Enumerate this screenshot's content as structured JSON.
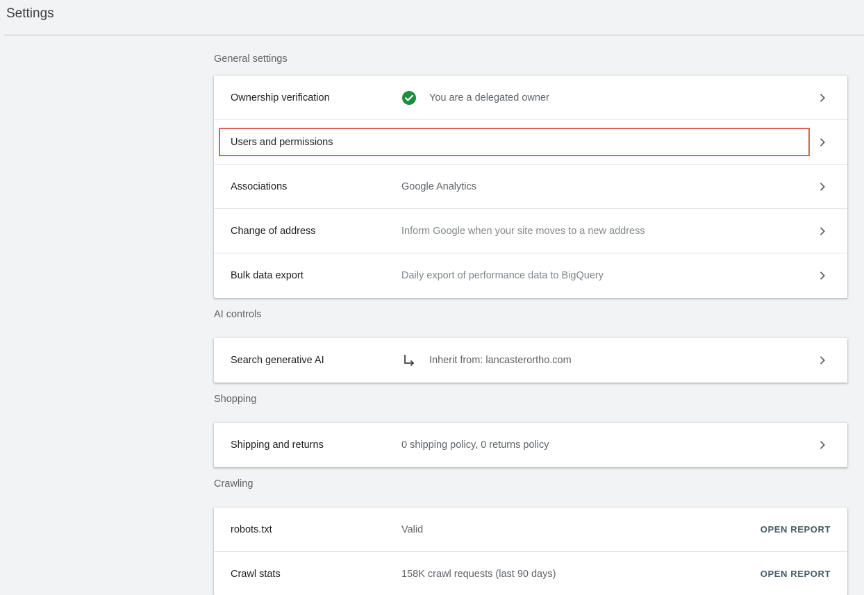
{
  "header": {
    "title": "Settings"
  },
  "sections": {
    "general": {
      "title": "General settings",
      "rows": {
        "ownership": {
          "label": "Ownership verification",
          "value": "You are a delegated owner",
          "icon": "check-circle-icon"
        },
        "users": {
          "label": "Users and permissions"
        },
        "associations": {
          "label": "Associations",
          "value": "Google Analytics"
        },
        "address": {
          "label": "Change of address",
          "value": "Inform Google when your site moves to a new address"
        },
        "bulk": {
          "label": "Bulk data export",
          "value": "Daily export of performance data to BigQuery"
        }
      }
    },
    "ai": {
      "title": "AI controls",
      "rows": {
        "generative": {
          "label": "Search generative AI",
          "value": "Inherit from: lancasterortho.com",
          "icon": "subdirectory-arrow-icon"
        }
      }
    },
    "shopping": {
      "title": "Shopping",
      "rows": {
        "shipping": {
          "label": "Shipping and returns",
          "value": "0 shipping policy, 0 returns policy"
        }
      }
    },
    "crawling": {
      "title": "Crawling",
      "rows": {
        "robots": {
          "label": "robots.txt",
          "value": "Valid",
          "action": "OPEN REPORT"
        },
        "crawlstats": {
          "label": "Crawl stats",
          "value": "158K crawl requests (last 90 days)",
          "action": "OPEN REPORT"
        }
      }
    }
  },
  "colors": {
    "background": "#f1f3f4",
    "card": "#ffffff",
    "success": "#1e8e3e",
    "highlight": "#e06055",
    "action": "#455a64"
  }
}
